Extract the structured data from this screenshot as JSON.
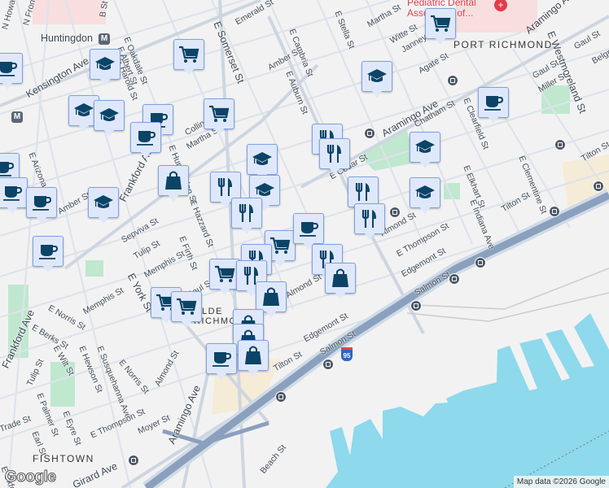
{
  "map": {
    "neighborhoods": [
      "PORT RICHMOND",
      "FISHTOWN",
      "OLDE RICHMOND"
    ],
    "transit_stations": [
      "Huntingdon"
    ],
    "poi": "Pediatric Dental Associates of...",
    "highway_shield": "95",
    "attribution": "Map data ©2026 Google",
    "logo": "Google",
    "colors": {
      "marker_icon": "#0b4466",
      "marker_bg": "#dfe8fa",
      "marker_border": "#7ea2e2",
      "water": "#8ed9ec",
      "highway": "#8aa0bd",
      "background": "#f3f2f3",
      "park": "#bfe8cf"
    }
  },
  "labels": [
    "N Howard",
    "N Front St",
    "B St",
    "Huntingdon",
    "E Oakdale St",
    "E Albert St",
    "E Harold St",
    "Kensington Ave",
    "E Somerset St",
    "Emerald St",
    "Amber St",
    "E Auburn St",
    "E Cambria St",
    "Martha St",
    "E Stella St",
    "Witte St",
    "Janney St",
    "Agate St",
    "Aramingo Ave",
    "E Westmoreland St",
    "Gaul St",
    "Miller St",
    "E Clearfield St",
    "Chatham St",
    "E Cedar St",
    "E Elkhart St",
    "E Clementine St",
    "E Indiana Ave",
    "Tilton St",
    "Almond St",
    "E Thompson St",
    "Edgemont St",
    "Salmon St",
    "E Arizona St",
    "Amber St",
    "Frankford Ave",
    "Sepviva St",
    "Tulip St",
    "Memphis St",
    "E York St",
    "E Firth St",
    "E Hazzard St",
    "E Huntingdon St",
    "Collins St",
    "Martha St",
    "E Norris St",
    "Memphis St",
    "E Berks St",
    "E Wilt St",
    "E Hewson St",
    "E Susquehanna Ave",
    "E Norris St",
    "Almond St",
    "Frankford Ave",
    "Tulip St",
    "E Palmer St",
    "E Eyre St",
    "Earl St",
    "Trade St",
    "E Thompson St",
    "Moyer St",
    "Aramingo Ave",
    "Girard Ave",
    "Beach St",
    "Tilton St",
    "Edgemont St",
    "Salmon St",
    "Belgrade St",
    "Gaul St",
    "E Oxford St"
  ],
  "markers": [
    {
      "type": "school"
    },
    {
      "type": "grocery"
    },
    {
      "type": "school"
    },
    {
      "type": "school"
    },
    {
      "type": "cafe"
    },
    {
      "type": "cafe"
    },
    {
      "type": "grocery"
    },
    {
      "type": "school"
    },
    {
      "type": "shopping"
    },
    {
      "type": "restaurant"
    },
    {
      "type": "school"
    },
    {
      "type": "restaurant"
    },
    {
      "type": "grocery"
    },
    {
      "type": "cafe"
    },
    {
      "type": "restaurant"
    },
    {
      "type": "restaurant"
    },
    {
      "type": "shopping"
    },
    {
      "type": "grocery"
    },
    {
      "type": "restaurant"
    },
    {
      "type": "shopping"
    },
    {
      "type": "grocery"
    },
    {
      "type": "grocery"
    },
    {
      "type": "shopping"
    },
    {
      "type": "shopping"
    },
    {
      "type": "cafe"
    },
    {
      "type": "shopping"
    },
    {
      "type": "grocery"
    },
    {
      "type": "school"
    },
    {
      "type": "cafe"
    },
    {
      "type": "restaurant"
    },
    {
      "type": "restaurant"
    },
    {
      "type": "school"
    },
    {
      "type": "school"
    },
    {
      "type": "restaurant"
    },
    {
      "type": "restaurant"
    },
    {
      "type": "cafe"
    },
    {
      "type": "cafe"
    },
    {
      "type": "cafe"
    },
    {
      "type": "cafe"
    },
    {
      "type": "school"
    },
    {
      "type": "cafe"
    }
  ]
}
